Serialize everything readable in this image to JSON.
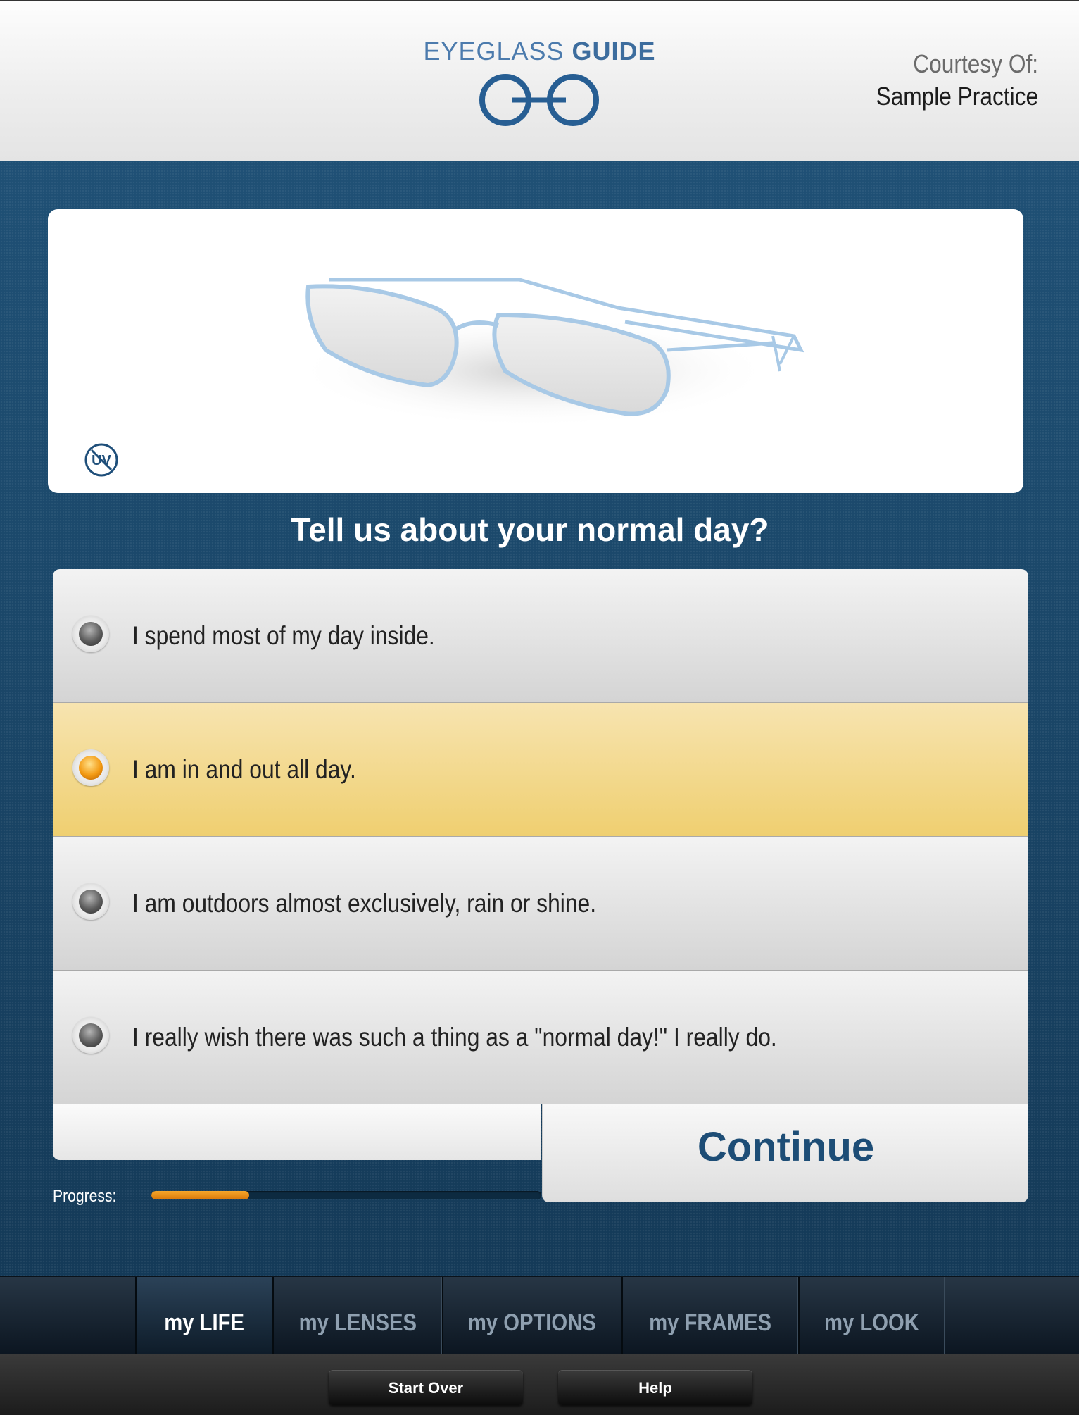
{
  "header": {
    "logo_text_part1": "EYEGLASS ",
    "logo_text_part2": "GUIDE",
    "courtesy_label": "Courtesy Of:",
    "courtesy_value": "Sample Practice"
  },
  "question": "Tell us about your normal day?",
  "options": [
    {
      "label": "I spend most of my day inside.",
      "selected": false
    },
    {
      "label": "I am in and out all day.",
      "selected": true
    },
    {
      "label": "I am outdoors almost exclusively, rain or shine.",
      "selected": false
    },
    {
      "label": "I really wish there was such a thing as a \"normal day!\" I really do.",
      "selected": false
    }
  ],
  "continue_label": "Continue",
  "progress": {
    "label": "Progress:",
    "value_percent": 25
  },
  "tabs": [
    {
      "label": "my LIFE",
      "active": true
    },
    {
      "label": "my LENSES",
      "active": false
    },
    {
      "label": "my OPTIONS",
      "active": false
    },
    {
      "label": "my FRAMES",
      "active": false
    },
    {
      "label": "my LOOK",
      "active": false
    }
  ],
  "footer": {
    "start_over_label": "Start Over",
    "help_label": "Help"
  },
  "icons": {
    "logo": "glasses-logo-icon",
    "uv": "uv-icon",
    "radio": "radio-button-icon"
  },
  "colors": {
    "accent": "#1d4d76",
    "selected_option": "#efcf70",
    "progress": "#e8890f",
    "background": "#1c4a6d"
  }
}
